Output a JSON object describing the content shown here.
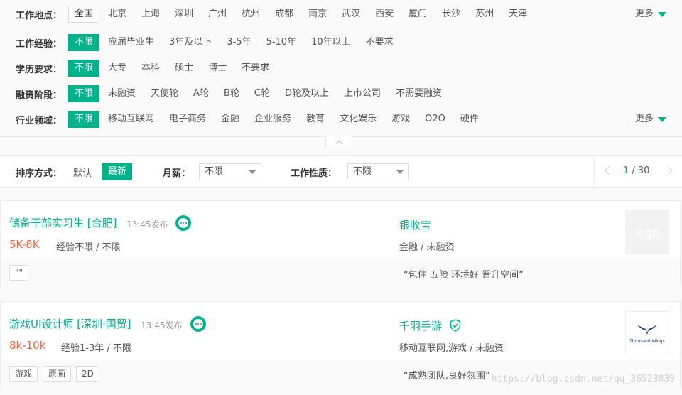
{
  "filters": {
    "location": {
      "label": "工作地点：",
      "options": [
        "全国",
        "北京",
        "上海",
        "深圳",
        "广州",
        "杭州",
        "成都",
        "南京",
        "武汉",
        "西安",
        "厦门",
        "长沙",
        "苏州",
        "天津"
      ],
      "more": "更多"
    },
    "experience": {
      "label": "工作经验：",
      "options": [
        "不限",
        "应届毕业生",
        "3年及以下",
        "3-5年",
        "5-10年",
        "10年以上",
        "不要求"
      ]
    },
    "education": {
      "label": "学历要求：",
      "options": [
        "不限",
        "大专",
        "本科",
        "硕士",
        "博士",
        "不要求"
      ]
    },
    "financing": {
      "label": "融资阶段：",
      "options": [
        "不限",
        "未融资",
        "天使轮",
        "A轮",
        "B轮",
        "C轮",
        "D轮及以上",
        "上市公司",
        "不需要融资"
      ]
    },
    "industry": {
      "label": "行业领域：",
      "options": [
        "不限",
        "移动互联网",
        "电子商务",
        "金融",
        "企业服务",
        "教育",
        "文化娱乐",
        "游戏",
        "O2O",
        "硬件"
      ],
      "more": "更多"
    }
  },
  "sort": {
    "label": "排序方式：",
    "default": "默认",
    "latest": "最新",
    "salary_label": "月薪：",
    "salary_value": "不限",
    "nature_label": "工作性质：",
    "nature_value": "不限",
    "page_current": "1",
    "page_total": " / 30"
  },
  "jobs": [
    {
      "title": "储备干部实习生 [合肥]",
      "time": "13:45发布",
      "salary": "5K-8K",
      "requirements": "经验不限 / 不限",
      "company": "银收宝",
      "industry": "金融 / 未融资",
      "logo_text": "logo",
      "tags": [
        "\"\""
      ],
      "welfare": "“包住 五险 环境好 晋升空间”"
    },
    {
      "title": "游戏UI设计师 [深圳·国贸]",
      "time": "13:45发布",
      "salary": "8k-10k",
      "requirements": "经验1-3年 / 不限",
      "company": "千羽手游",
      "industry": "移动互联网,游戏 / 未融资",
      "logo_text": "Thousand Wings",
      "tags": [
        "游戏",
        "原画",
        "2D"
      ],
      "welfare": "“成熟团队,良好氛围”"
    }
  ],
  "watermark": "https://blog.csdn.net/qq_36523839",
  "colors": {
    "accent": "#00b38a",
    "salary": "#fd5f39"
  }
}
